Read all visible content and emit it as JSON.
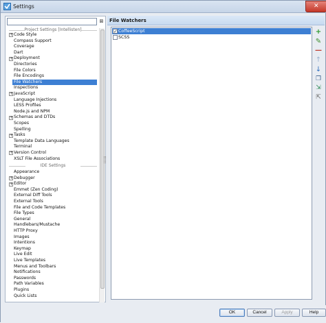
{
  "window": {
    "title": "Settings",
    "close_glyph": "✕",
    "colors": {
      "titlebar": "#c6d5e8",
      "selection": "#3d7fd3",
      "close": "#c5382a"
    }
  },
  "search": {
    "value": "",
    "placeholder": "",
    "clear_glyph": "⊠"
  },
  "sections": {
    "project": "Project Settings [Intellisten]",
    "ide": "IDE Settings"
  },
  "project_items": [
    {
      "label": "Code Style",
      "expandable": true
    },
    {
      "label": "Compass Support",
      "expandable": false
    },
    {
      "label": "Coverage",
      "expandable": false
    },
    {
      "label": "Dart",
      "expandable": false
    },
    {
      "label": "Deployment",
      "expandable": true
    },
    {
      "label": "Directories",
      "expandable": false
    },
    {
      "label": "File Colors",
      "expandable": false
    },
    {
      "label": "File Encodings",
      "expandable": false
    },
    {
      "label": "File Watchers",
      "expandable": false,
      "selected": true
    },
    {
      "label": "Inspections",
      "expandable": false
    },
    {
      "label": "JavaScript",
      "expandable": true
    },
    {
      "label": "Language Injections",
      "expandable": false
    },
    {
      "label": "LESS Profiles",
      "expandable": false
    },
    {
      "label": "Node.js and NPM",
      "expandable": false
    },
    {
      "label": "Schemas and DTDs",
      "expandable": true
    },
    {
      "label": "Scopes",
      "expandable": false
    },
    {
      "label": "Spelling",
      "expandable": false
    },
    {
      "label": "Tasks",
      "expandable": true
    },
    {
      "label": "Template Data Languages",
      "expandable": false
    },
    {
      "label": "Terminal",
      "expandable": false
    },
    {
      "label": "Version Control",
      "expandable": true
    },
    {
      "label": "XSLT File Associations",
      "expandable": false
    }
  ],
  "ide_items": [
    {
      "label": "Appearance",
      "expandable": false
    },
    {
      "label": "Debugger",
      "expandable": true
    },
    {
      "label": "Editor",
      "expandable": true
    },
    {
      "label": "Emmet (Zen Coding)",
      "expandable": false
    },
    {
      "label": "External Diff Tools",
      "expandable": false
    },
    {
      "label": "External Tools",
      "expandable": false
    },
    {
      "label": "File and Code Templates",
      "expandable": false
    },
    {
      "label": "File Types",
      "expandable": false
    },
    {
      "label": "General",
      "expandable": false
    },
    {
      "label": "Handlebars/Mustache",
      "expandable": false
    },
    {
      "label": "HTTP Proxy",
      "expandable": false
    },
    {
      "label": "Images",
      "expandable": false
    },
    {
      "label": "Intentions",
      "expandable": false
    },
    {
      "label": "Keymap",
      "expandable": false
    },
    {
      "label": "Live Edit",
      "expandable": false
    },
    {
      "label": "Live Templates",
      "expandable": false
    },
    {
      "label": "Menus and Toolbars",
      "expandable": false
    },
    {
      "label": "Notifications",
      "expandable": false
    },
    {
      "label": "Passwords",
      "expandable": false
    },
    {
      "label": "Path Variables",
      "expandable": false
    },
    {
      "label": "Plugins",
      "expandable": false
    },
    {
      "label": "Quick Lists",
      "expandable": false
    }
  ],
  "right": {
    "title": "File Watchers",
    "watchers": [
      {
        "label": "CoffeeScript",
        "checked": true,
        "selected": true
      },
      {
        "label": "SCSS",
        "checked": false,
        "selected": false
      }
    ],
    "tools": {
      "add": "+",
      "edit": "✎",
      "remove": "—",
      "up": "↑",
      "down": "↓",
      "copy": "❐",
      "import": "⇲",
      "export": "⇱"
    }
  },
  "buttons": {
    "ok": "OK",
    "cancel": "Cancel",
    "apply": "Apply",
    "help": "Help"
  }
}
